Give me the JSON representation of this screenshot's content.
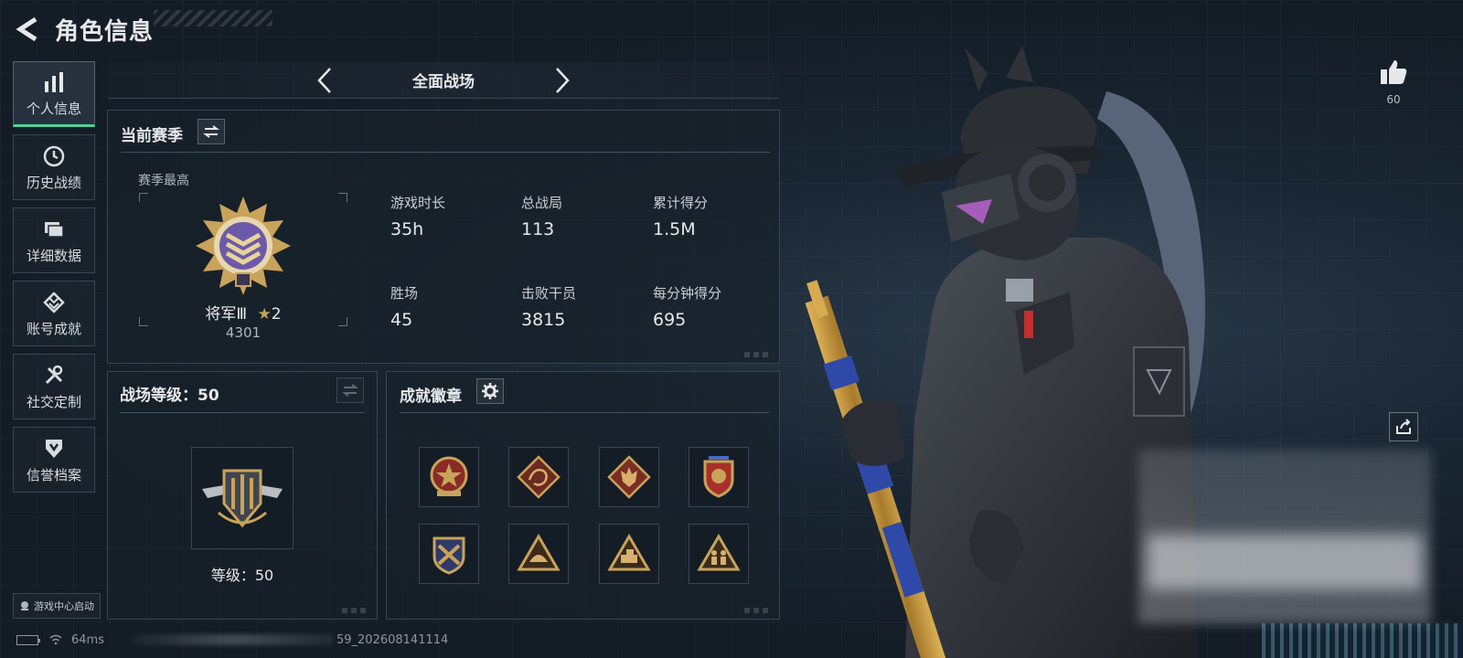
{
  "header": {
    "title": "角色信息"
  },
  "sidebar": {
    "items": [
      {
        "label": "个人信息",
        "icon": "bar-chart-icon",
        "active": true
      },
      {
        "label": "历史战绩",
        "icon": "history-clock-icon",
        "active": false
      },
      {
        "label": "详细数据",
        "icon": "folder-icon",
        "active": false
      },
      {
        "label": "账号成就",
        "icon": "achievement-icon",
        "active": false
      },
      {
        "label": "社交定制",
        "icon": "tools-icon",
        "active": false
      },
      {
        "label": "信誉档案",
        "icon": "credit-shield-icon",
        "active": false
      }
    ],
    "launch_label": "游戏中心启动"
  },
  "mode_nav": {
    "current": "全面战场"
  },
  "season": {
    "title": "当前赛季",
    "best_label": "赛季最高",
    "rank_name": "将军Ⅲ",
    "rank_stars": "2",
    "rank_score": "4301",
    "stats": [
      {
        "label": "游戏时长",
        "value": "35h"
      },
      {
        "label": "总战局",
        "value": "113"
      },
      {
        "label": "累计得分",
        "value": "1.5M"
      },
      {
        "label": "胜场",
        "value": "45"
      },
      {
        "label": "击败干员",
        "value": "3815"
      },
      {
        "label": "每分钟得分",
        "value": "695"
      }
    ]
  },
  "level": {
    "title": "战场等级：50",
    "level_text": "等级：50"
  },
  "badges": {
    "title": "成就徽章",
    "count": 8
  },
  "like": {
    "count": "60"
  },
  "status": {
    "ping": "64ms",
    "build": "59_202608141114"
  },
  "colors": {
    "accent": "#4fd39a",
    "gold": "#c9a35a",
    "panel_border": "#3b4552"
  }
}
